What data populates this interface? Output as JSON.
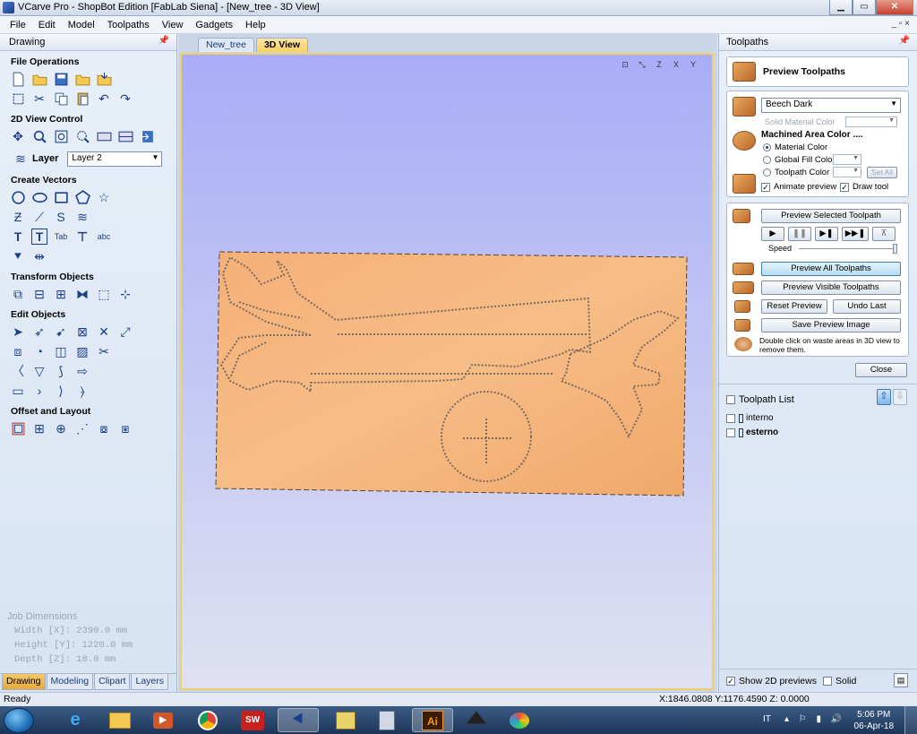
{
  "window": {
    "title": "VCarve Pro - ShopBot Edition [FabLab Siena] - [New_tree - 3D View]"
  },
  "menu": {
    "items": [
      "File",
      "Edit",
      "Model",
      "Toolpaths",
      "View",
      "Gadgets",
      "Help"
    ],
    "right_controls": "_ ▫ ×"
  },
  "left_panel": {
    "title": "Drawing",
    "sections": {
      "file_ops": "File Operations",
      "view_control": "2D View Control",
      "layer_label": "Layer",
      "layer_value": "Layer 2",
      "create_vectors": "Create Vectors",
      "transform": "Transform Objects",
      "edit": "Edit Objects",
      "offset": "Offset and Layout"
    },
    "job": {
      "title": "Job Dimensions",
      "width": "Width  [X]: 2390.0 mm",
      "height": "Height [Y]: 1220.0 mm",
      "depth": "Depth  [Z]: 18.0 mm"
    },
    "tabs": [
      "Drawing",
      "Modeling",
      "Clipart",
      "Layers"
    ]
  },
  "doc_tabs": [
    "New_tree",
    "3D View"
  ],
  "right_panel": {
    "title": "Toolpaths",
    "preview_title": "Preview Toolpaths",
    "material": "Beech Dark",
    "solid_material_color": "Solid Material Color",
    "machined_area_color": "Machined Area Color ....",
    "radio_material": "Material Color",
    "radio_global": "Global Fill Color",
    "radio_toolpath": "Toolpath Color",
    "set_all": "Set All",
    "animate_preview": "Animate preview",
    "draw_tool": "Draw tool",
    "btn_preview_selected": "Preview Selected Toolpath",
    "speed": "Speed",
    "speed_level": 1.0,
    "btn_preview_all": "Preview All Toolpaths",
    "btn_preview_visible": "Preview Visible Toolpaths",
    "btn_reset": "Reset Preview",
    "btn_undo": "Undo Last",
    "btn_save_image": "Save Preview Image",
    "hint": "Double click on waste areas in 3D view to remove them.",
    "btn_close": "Close",
    "toolpath_list_title": "Toolpath List",
    "toolpaths": [
      "interno",
      "esterno"
    ],
    "show_2d": "Show 2D previews",
    "solid": "Solid"
  },
  "status": {
    "left": "Ready",
    "coords": "X:1846.0808 Y:1176.4590 Z:  0.0000"
  },
  "taskbar": {
    "lang": "IT",
    "time": "5:06 PM",
    "date": "06-Apr-18"
  },
  "colors": {
    "view_bg_top": "#a9adf6",
    "board": "#f0a86a",
    "accent_tab": "#f3cf6a"
  }
}
